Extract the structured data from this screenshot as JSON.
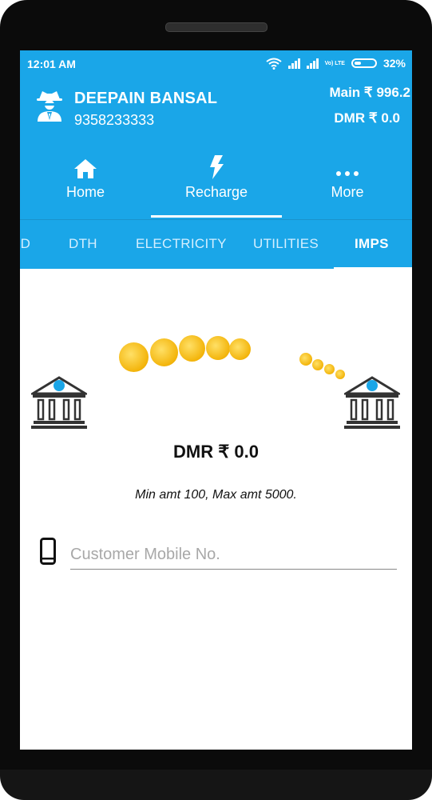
{
  "status": {
    "time": "12:01 AM",
    "battery": "32%",
    "volte": "Vo) LTE"
  },
  "user": {
    "name": "DEEPAIN BANSAL",
    "mobile": "9358233333"
  },
  "balances": {
    "main": "Main ₹ 996.2",
    "dmr": "DMR ₹ 0.0"
  },
  "nav": [
    {
      "label": "Home",
      "icon": "home-icon"
    },
    {
      "label": "Recharge",
      "icon": "lightning-icon",
      "active": true
    },
    {
      "label": "More",
      "icon": "more-dots-icon"
    }
  ],
  "subtabs": [
    "RD",
    "DTH",
    "ELECTRICITY",
    "UTILITIES",
    "IMPS"
  ],
  "active_subtab": "IMPS",
  "transfer": {
    "dmr_balance": "DMR ₹ 0.0",
    "limits": "Min amt 100, Max amt 5000."
  },
  "form": {
    "mobile_placeholder": "Customer Mobile No."
  },
  "colors": {
    "primary": "#1aa6e8",
    "coin": "#f3b40a"
  }
}
